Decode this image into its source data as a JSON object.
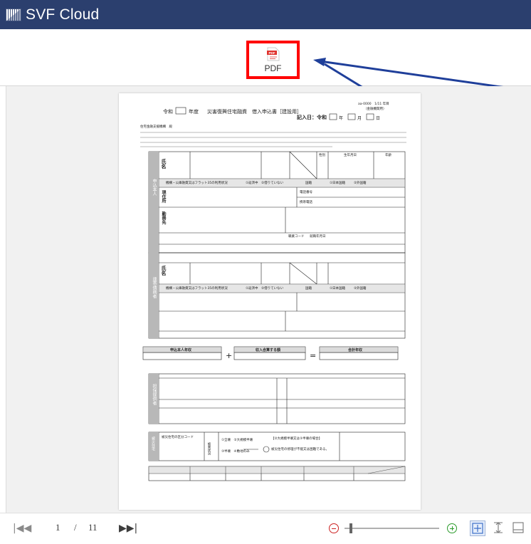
{
  "app": {
    "title": "SVF Cloud"
  },
  "toolbar": {
    "pdf_label": "PDF",
    "pdf_icon": "pdf-file-icon"
  },
  "document": {
    "era_label": "令和",
    "year_suffix": "年度",
    "form_title": "災害復興住宅融資　借入申込書［建設用］",
    "form_code": "aa-0000　1/11 年目",
    "form_code_note": "（金融機関用）",
    "entry_date_label": "記入日：令和",
    "date_units": [
      "年",
      "月",
      "日"
    ],
    "addressee": "住宅金融支援機構　殿",
    "section_applicant": "申込本人",
    "section_co_borrower": "連帯債務者",
    "section_collateral": "担保提供者",
    "section_property": "被災住宅",
    "labels": {
      "name": "氏名",
      "address": "現住所",
      "workplace": "勤務先",
      "gender": "性別",
      "birthdate": "生年月日",
      "age": "年齢",
      "nationality": "国籍",
      "japan": "①日本国籍",
      "foreign": "②外国籍",
      "phone": "電話番号",
      "mobile": "携帯電話",
      "repaying": "①返済中　②借りていない",
      "flat35": "機構・公庫融資又はフラット35の利用状況",
      "occupation_code": "職業コード",
      "years_employed": "就職年月日"
    },
    "income": {
      "applicant": "申込本人年収",
      "other": "収入合算する額",
      "total": "合計年収"
    },
    "property": {
      "code": "被災住宅の区分コード",
      "state": "被害状況",
      "option1": "①全壊　②大規模半壊",
      "option2": "③半壊　④敷地のみ",
      "note": "【②大規模半壊又は③半壊の場合】",
      "note2": "被災住宅の修理が不能又は困難である。"
    }
  },
  "pager": {
    "current": "1",
    "separator": "/",
    "total": "11",
    "first_icon": "first-page-icon",
    "prev_icon": "prev-page-icon",
    "next_icon": "next-page-icon",
    "last_icon": "last-page-icon"
  },
  "zoom": {
    "level": 0.05,
    "minus_icon": "zoom-out-icon",
    "plus_icon": "zoom-in-icon"
  },
  "view_modes": [
    "fit-page-icon",
    "fit-height-icon",
    "fit-width-icon"
  ],
  "colors": {
    "titlebar": "#2b3f6e",
    "highlight": "#ff0000",
    "arrow": "#1f3f9a",
    "viewer_bg": "#f1f1f1",
    "section_fill": "#b8b8b8"
  }
}
